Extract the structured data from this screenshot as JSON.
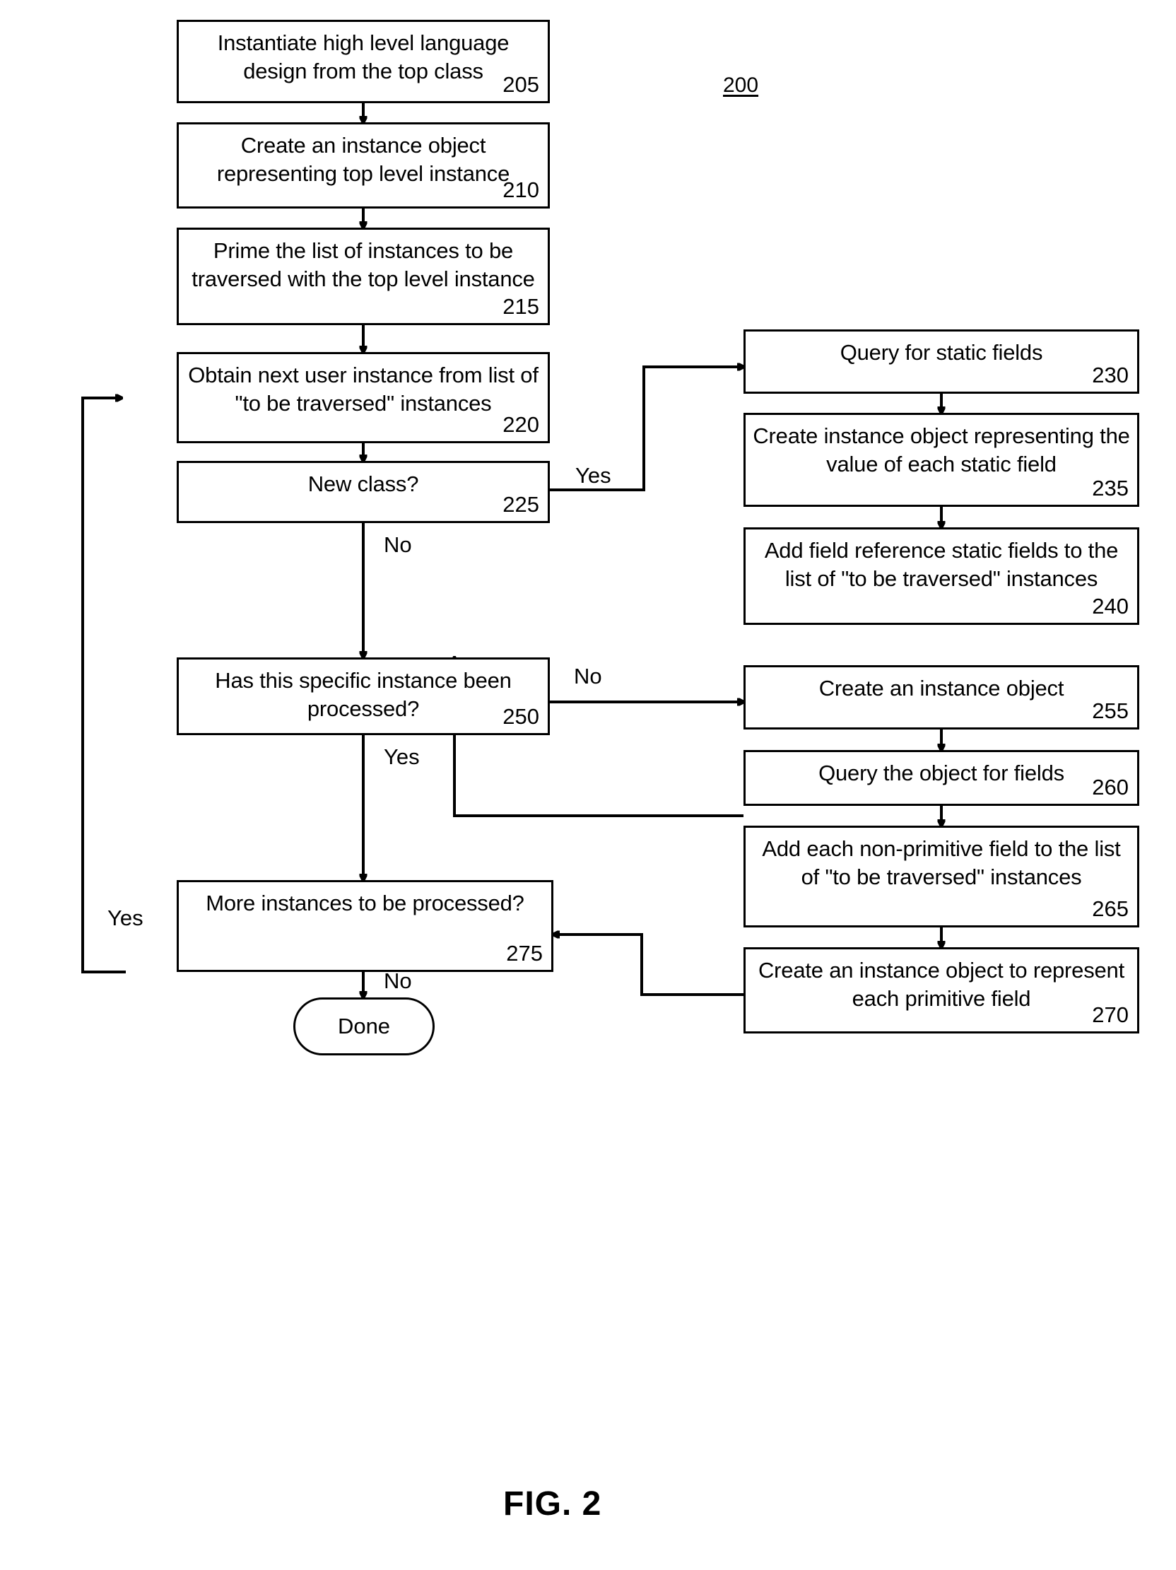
{
  "figure": {
    "number_label": "200",
    "caption": "FIG. 2"
  },
  "nodes": [
    {
      "id": "n205",
      "text": "Instantiate high level language design from the top class",
      "ref": "205",
      "shape": "process"
    },
    {
      "id": "n210",
      "text": "Create an instance object representing top level instance",
      "ref": "210",
      "shape": "process"
    },
    {
      "id": "n215",
      "text": "Prime the list of instances to be traversed with the top level instance",
      "ref": "215",
      "shape": "process"
    },
    {
      "id": "n220",
      "text": "Obtain next user instance from list of \"to be traversed\" instances",
      "ref": "220",
      "shape": "process"
    },
    {
      "id": "n225",
      "text": "New class?",
      "ref": "225",
      "shape": "decision"
    },
    {
      "id": "n230",
      "text": "Query for static fields",
      "ref": "230",
      "shape": "process"
    },
    {
      "id": "n235",
      "text": "Create instance object representing the value of each static field",
      "ref": "235",
      "shape": "process"
    },
    {
      "id": "n240",
      "text": "Add field reference static fields to the list of \"to be traversed\" instances",
      "ref": "240",
      "shape": "process"
    },
    {
      "id": "n250",
      "text": "Has this specific instance been processed?",
      "ref": "250",
      "shape": "decision"
    },
    {
      "id": "n255",
      "text": "Create an instance object",
      "ref": "255",
      "shape": "process"
    },
    {
      "id": "n260",
      "text": "Query the object for fields",
      "ref": "260",
      "shape": "process"
    },
    {
      "id": "n265",
      "text": "Add each non-primitive field to the list of \"to be traversed\" instances",
      "ref": "265",
      "shape": "process"
    },
    {
      "id": "n270",
      "text": "Create an instance object to represent each primitive field",
      "ref": "270",
      "shape": "process"
    },
    {
      "id": "n275",
      "text": "More instances to be processed?",
      "ref": "275",
      "shape": "decision"
    },
    {
      "id": "nDone",
      "text": "Done",
      "ref": "",
      "shape": "terminator"
    }
  ],
  "edge_labels": [
    {
      "id": "e225yes",
      "text": "Yes"
    },
    {
      "id": "e225no",
      "text": "No"
    },
    {
      "id": "e250no",
      "text": "No"
    },
    {
      "id": "e250yes",
      "text": "Yes"
    },
    {
      "id": "e275yes",
      "text": "Yes"
    },
    {
      "id": "e275no",
      "text": "No"
    }
  ]
}
